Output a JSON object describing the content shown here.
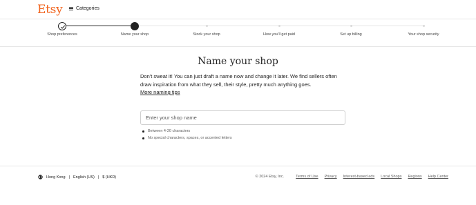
{
  "header": {
    "logo": "Etsy",
    "categories_label": "Categories"
  },
  "progress": {
    "steps": [
      {
        "label": "Shop preferences",
        "state": "done"
      },
      {
        "label": "Name your shop",
        "state": "current"
      },
      {
        "label": "Stock your shop",
        "state": "upcoming"
      },
      {
        "label": "How you'll get paid",
        "state": "upcoming"
      },
      {
        "label": "Set up billing",
        "state": "upcoming"
      },
      {
        "label": "Your shop security",
        "state": "upcoming"
      }
    ]
  },
  "main": {
    "title": "Name your shop",
    "intro": "Don't sweat it! You can just draft a name now and change it later. We find sellers often draw inspiration from what they sell, their style, pretty much anything goes.",
    "tips_link": "More naming tips",
    "input_placeholder": "Enter your shop name",
    "input_value": "",
    "rules": [
      "Between 4-20 characters",
      "No special characters, spaces, or accented letters"
    ]
  },
  "footer": {
    "region": "Hong Kong",
    "language": "English (US)",
    "currency": "$ (HKD)",
    "copyright": "© 2024 Etsy, Inc.",
    "links": [
      "Terms of Use",
      "Privacy",
      "Interest-based ads",
      "Local Shops",
      "Regions",
      "Help Center"
    ]
  },
  "colors": {
    "brand": "#f1641e",
    "text": "#222222",
    "muted": "#595959",
    "border": "#e6e6e6"
  }
}
